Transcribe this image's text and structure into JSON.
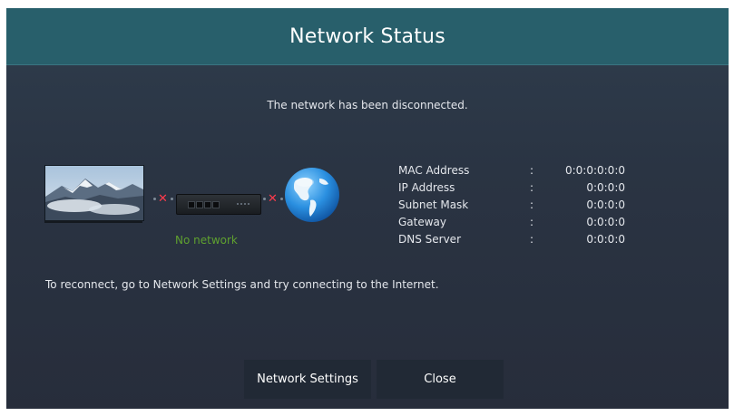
{
  "dialog": {
    "title": "Network Status",
    "message": "The network has been disconnected.",
    "hint": "To reconnect, go to Network Settings and try connecting to the Internet."
  },
  "diagram": {
    "status_text": "No network",
    "status_color": "#5fa12f",
    "error_color": "#ff3b4c",
    "icons": [
      "tv-icon",
      "router-icon",
      "globe-icon"
    ]
  },
  "info": [
    {
      "label": "MAC Address",
      "value": "0:0:0:0:0:0"
    },
    {
      "label": "IP Address",
      "value": "0:0:0:0"
    },
    {
      "label": "Subnet Mask",
      "value": "0:0:0:0"
    },
    {
      "label": "Gateway",
      "value": "0:0:0:0"
    },
    {
      "label": "DNS Server",
      "value": "0:0:0:0"
    }
  ],
  "separator": ":",
  "buttons": {
    "network_settings": "Network Settings",
    "close": "Close"
  },
  "colors": {
    "header": "#285f6b",
    "panel": "#2a3443",
    "button": "#212935"
  }
}
